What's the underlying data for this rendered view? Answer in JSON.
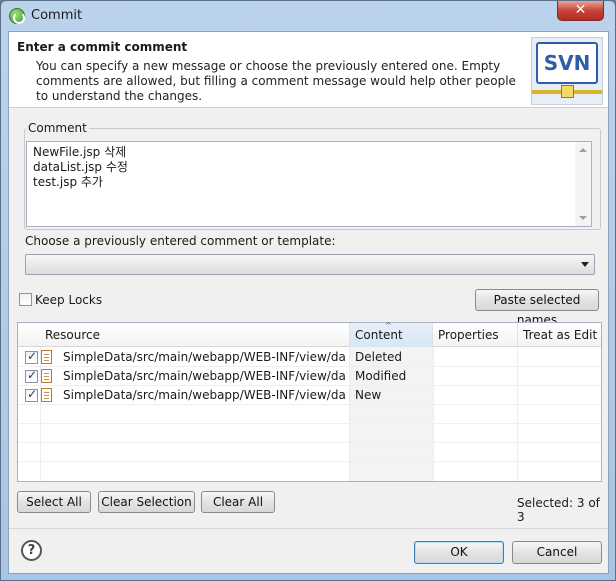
{
  "window": {
    "title": "Commit",
    "close_glyph": "✕"
  },
  "header": {
    "title": "Enter a commit comment",
    "description": "You can specify a new message or choose the previously entered one. Empty comments are allowed, but filling a comment message would help other people to understand the changes.",
    "logo_text": "SVN"
  },
  "comment": {
    "group_label": "Comment",
    "lines": [
      "NewFile.jsp 삭제",
      "dataList.jsp 수정",
      "test.jsp 추가"
    ]
  },
  "template": {
    "label": "Choose a previously entered comment or template:",
    "selected_value": ""
  },
  "options": {
    "keep_locks_label": "Keep Locks",
    "keep_locks_checked": false,
    "paste_button": "Paste selected names"
  },
  "table": {
    "columns": [
      "Resource",
      "Content",
      "Properties",
      "Treat as Edit"
    ],
    "rows": [
      {
        "checked": true,
        "resource": "SimpleData/src/main/webapp/WEB-INF/view/dat...",
        "content": "Deleted",
        "properties": "",
        "treat_as_edit": ""
      },
      {
        "checked": true,
        "resource": "SimpleData/src/main/webapp/WEB-INF/view/dat...",
        "content": "Modified",
        "properties": "",
        "treat_as_edit": ""
      },
      {
        "checked": true,
        "resource": "SimpleData/src/main/webapp/WEB-INF/view/dat...",
        "content": "New",
        "properties": "",
        "treat_as_edit": ""
      }
    ]
  },
  "selection": {
    "select_all": "Select All",
    "clear_selection": "Clear Selection",
    "clear_all": "Clear All",
    "status": "Selected: 3 of 3"
  },
  "footer": {
    "help_glyph": "?",
    "ok": "OK",
    "cancel": "Cancel"
  },
  "colors": {
    "accent": "#3c7fb1",
    "close_red": "#c7433a",
    "svn_blue": "#2d5ea6"
  }
}
